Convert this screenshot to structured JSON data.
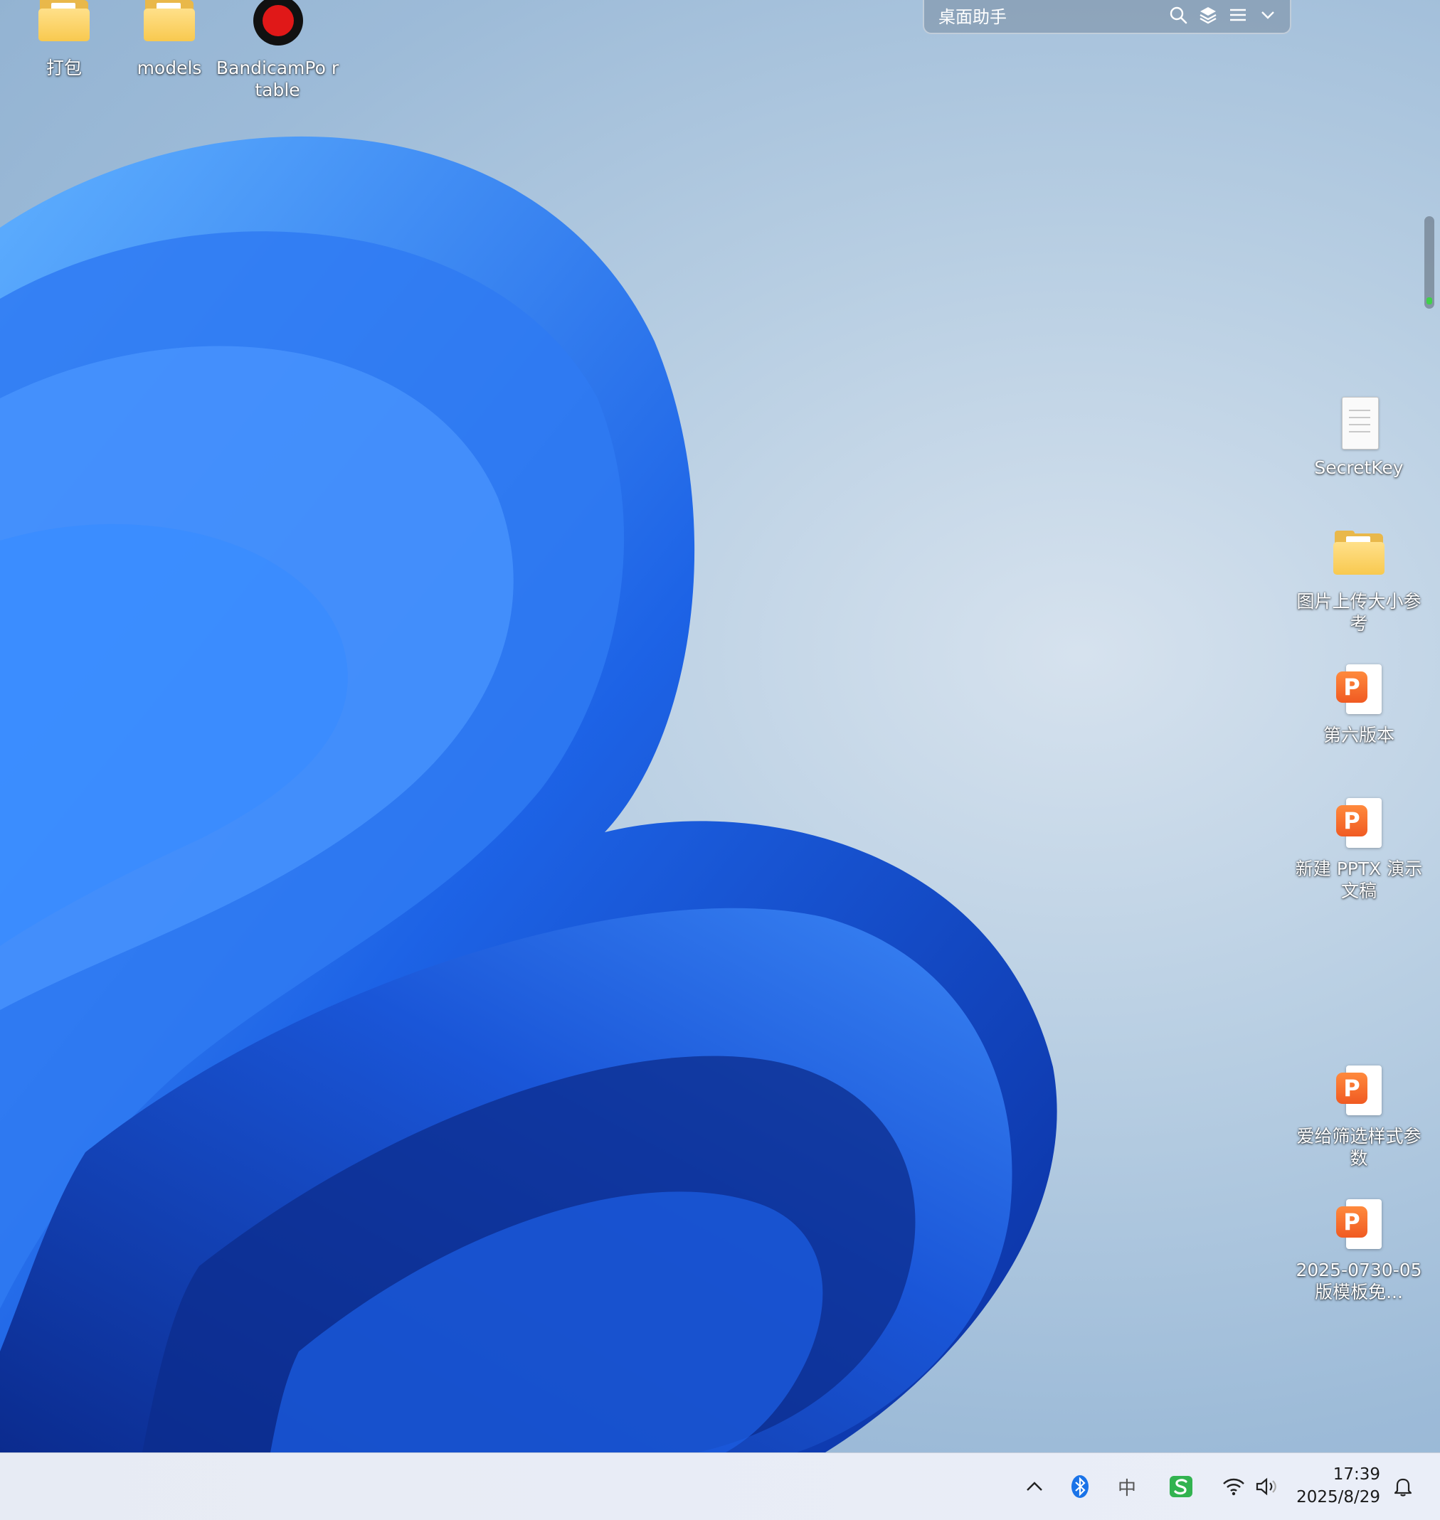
{
  "desktop_icons": [
    {
      "label": "打包",
      "kind": "folder"
    },
    {
      "label": "models",
      "kind": "folder"
    },
    {
      "label": "BandicamPo rtable",
      "kind": "bandicam"
    },
    {
      "label": "SecretKey",
      "kind": "text-file"
    },
    {
      "label": "图片上传大小参考",
      "kind": "folder"
    },
    {
      "label": "第六版本",
      "kind": "wps-presentation"
    },
    {
      "label": "新建 PPTX 演示文稿",
      "kind": "wps-presentation"
    },
    {
      "label": "爱给筛选样式参数",
      "kind": "wps-presentation"
    },
    {
      "label": "2025-0730-05版模板免...",
      "kind": "wps-presentation"
    }
  ],
  "helper_bar": {
    "title": "桌面助手",
    "icons": [
      "search-icon",
      "layers-icon",
      "menu-icon",
      "chevron-down-icon"
    ]
  },
  "taskbar": {
    "tray_icons": [
      "show-hidden-icons-chevron",
      "bluetooth-icon",
      "input-method-icon",
      "sogou-input-icon",
      "wifi-icon",
      "volume-icon"
    ],
    "ime_label": "中",
    "time": "17:39",
    "date": "2025/8/29"
  },
  "colors": {
    "wallpaper_blue": "#1f5fe0",
    "wallpaper_bg": "#b9cfe3",
    "taskbar_bg": "#e9edf6",
    "bluetooth": "#1a73e8",
    "sogou": "#32b350",
    "wps_orange": "#f26b2a"
  }
}
